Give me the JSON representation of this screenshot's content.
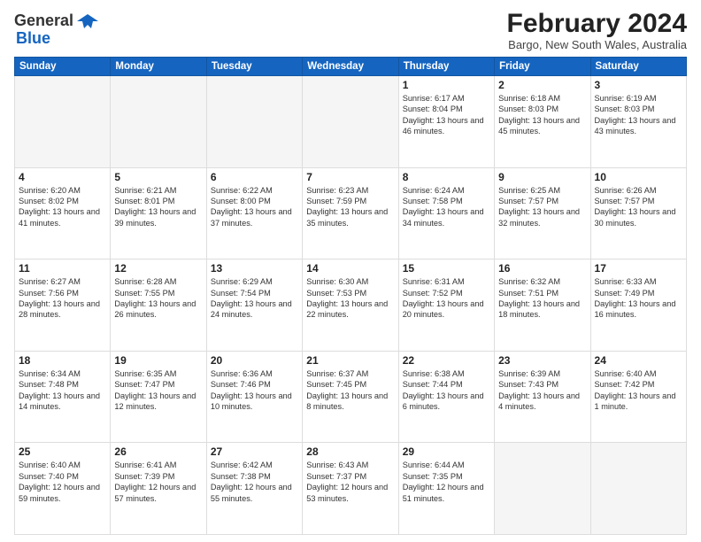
{
  "header": {
    "logo_general": "General",
    "logo_blue": "Blue",
    "month_year": "February 2024",
    "location": "Bargo, New South Wales, Australia"
  },
  "days_of_week": [
    "Sunday",
    "Monday",
    "Tuesday",
    "Wednesday",
    "Thursday",
    "Friday",
    "Saturday"
  ],
  "weeks": [
    [
      {
        "day": "",
        "info": ""
      },
      {
        "day": "",
        "info": ""
      },
      {
        "day": "",
        "info": ""
      },
      {
        "day": "",
        "info": ""
      },
      {
        "day": "1",
        "info": "Sunrise: 6:17 AM\nSunset: 8:04 PM\nDaylight: 13 hours\nand 46 minutes."
      },
      {
        "day": "2",
        "info": "Sunrise: 6:18 AM\nSunset: 8:03 PM\nDaylight: 13 hours\nand 45 minutes."
      },
      {
        "day": "3",
        "info": "Sunrise: 6:19 AM\nSunset: 8:03 PM\nDaylight: 13 hours\nand 43 minutes."
      }
    ],
    [
      {
        "day": "4",
        "info": "Sunrise: 6:20 AM\nSunset: 8:02 PM\nDaylight: 13 hours\nand 41 minutes."
      },
      {
        "day": "5",
        "info": "Sunrise: 6:21 AM\nSunset: 8:01 PM\nDaylight: 13 hours\nand 39 minutes."
      },
      {
        "day": "6",
        "info": "Sunrise: 6:22 AM\nSunset: 8:00 PM\nDaylight: 13 hours\nand 37 minutes."
      },
      {
        "day": "7",
        "info": "Sunrise: 6:23 AM\nSunset: 7:59 PM\nDaylight: 13 hours\nand 35 minutes."
      },
      {
        "day": "8",
        "info": "Sunrise: 6:24 AM\nSunset: 7:58 PM\nDaylight: 13 hours\nand 34 minutes."
      },
      {
        "day": "9",
        "info": "Sunrise: 6:25 AM\nSunset: 7:57 PM\nDaylight: 13 hours\nand 32 minutes."
      },
      {
        "day": "10",
        "info": "Sunrise: 6:26 AM\nSunset: 7:57 PM\nDaylight: 13 hours\nand 30 minutes."
      }
    ],
    [
      {
        "day": "11",
        "info": "Sunrise: 6:27 AM\nSunset: 7:56 PM\nDaylight: 13 hours\nand 28 minutes."
      },
      {
        "day": "12",
        "info": "Sunrise: 6:28 AM\nSunset: 7:55 PM\nDaylight: 13 hours\nand 26 minutes."
      },
      {
        "day": "13",
        "info": "Sunrise: 6:29 AM\nSunset: 7:54 PM\nDaylight: 13 hours\nand 24 minutes."
      },
      {
        "day": "14",
        "info": "Sunrise: 6:30 AM\nSunset: 7:53 PM\nDaylight: 13 hours\nand 22 minutes."
      },
      {
        "day": "15",
        "info": "Sunrise: 6:31 AM\nSunset: 7:52 PM\nDaylight: 13 hours\nand 20 minutes."
      },
      {
        "day": "16",
        "info": "Sunrise: 6:32 AM\nSunset: 7:51 PM\nDaylight: 13 hours\nand 18 minutes."
      },
      {
        "day": "17",
        "info": "Sunrise: 6:33 AM\nSunset: 7:49 PM\nDaylight: 13 hours\nand 16 minutes."
      }
    ],
    [
      {
        "day": "18",
        "info": "Sunrise: 6:34 AM\nSunset: 7:48 PM\nDaylight: 13 hours\nand 14 minutes."
      },
      {
        "day": "19",
        "info": "Sunrise: 6:35 AM\nSunset: 7:47 PM\nDaylight: 13 hours\nand 12 minutes."
      },
      {
        "day": "20",
        "info": "Sunrise: 6:36 AM\nSunset: 7:46 PM\nDaylight: 13 hours\nand 10 minutes."
      },
      {
        "day": "21",
        "info": "Sunrise: 6:37 AM\nSunset: 7:45 PM\nDaylight: 13 hours\nand 8 minutes."
      },
      {
        "day": "22",
        "info": "Sunrise: 6:38 AM\nSunset: 7:44 PM\nDaylight: 13 hours\nand 6 minutes."
      },
      {
        "day": "23",
        "info": "Sunrise: 6:39 AM\nSunset: 7:43 PM\nDaylight: 13 hours\nand 4 minutes."
      },
      {
        "day": "24",
        "info": "Sunrise: 6:40 AM\nSunset: 7:42 PM\nDaylight: 13 hours\nand 1 minute."
      }
    ],
    [
      {
        "day": "25",
        "info": "Sunrise: 6:40 AM\nSunset: 7:40 PM\nDaylight: 12 hours\nand 59 minutes."
      },
      {
        "day": "26",
        "info": "Sunrise: 6:41 AM\nSunset: 7:39 PM\nDaylight: 12 hours\nand 57 minutes."
      },
      {
        "day": "27",
        "info": "Sunrise: 6:42 AM\nSunset: 7:38 PM\nDaylight: 12 hours\nand 55 minutes."
      },
      {
        "day": "28",
        "info": "Sunrise: 6:43 AM\nSunset: 7:37 PM\nDaylight: 12 hours\nand 53 minutes."
      },
      {
        "day": "29",
        "info": "Sunrise: 6:44 AM\nSunset: 7:35 PM\nDaylight: 12 hours\nand 51 minutes."
      },
      {
        "day": "",
        "info": ""
      },
      {
        "day": "",
        "info": ""
      }
    ]
  ]
}
